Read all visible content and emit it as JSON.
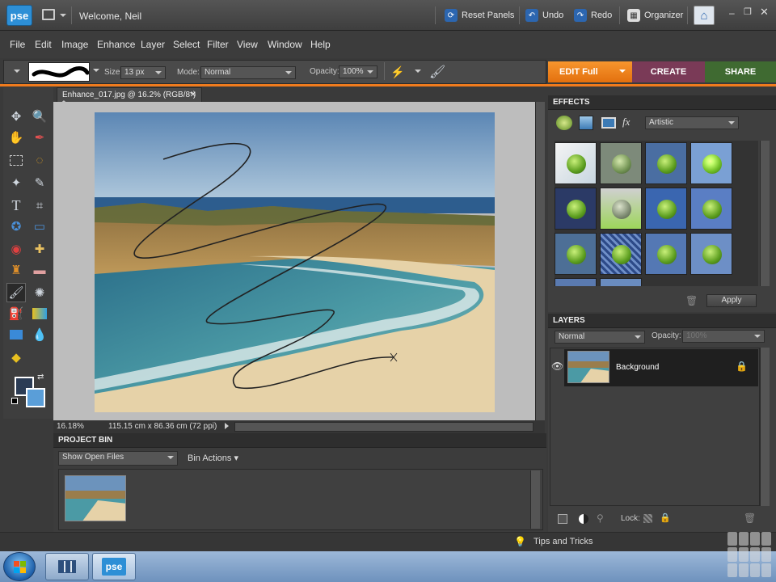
{
  "titlebar": {
    "app_logo": "pse",
    "welcome": "Welcome, Neil",
    "reset_panels": "Reset Panels",
    "undo": "Undo",
    "redo": "Redo",
    "organizer": "Organizer"
  },
  "menu": [
    "File",
    "Edit",
    "Image",
    "Enhance",
    "Layer",
    "Select",
    "Filter",
    "View",
    "Window",
    "Help"
  ],
  "options": {
    "size_label": "Size:",
    "size_value": "13 px",
    "mode_label": "Mode:",
    "mode_value": "Normal",
    "opacity_label": "Opacity:",
    "opacity_value": "100%"
  },
  "mode_tabs": {
    "edit": "EDIT Full",
    "create": "CREATE",
    "share": "SHARE"
  },
  "document": {
    "tab_title": "Enhance_017.jpg @ 16.2% (RGB/8*) *",
    "zoom": "16.18%",
    "dimensions": "115.15 cm x 86.36 cm (72 ppi)"
  },
  "bin": {
    "title": "PROJECT BIN",
    "show_value": "Show Open Files",
    "actions": "Bin Actions"
  },
  "effects": {
    "title": "EFFECTS",
    "category": "Artistic",
    "apply": "Apply"
  },
  "layers": {
    "title": "LAYERS",
    "blend": "Normal",
    "opacity_label": "Opacity:",
    "opacity_value": "100%",
    "layer_name": "Background",
    "lock_label": "Lock:"
  },
  "status": {
    "tips": "Tips and Tricks"
  },
  "taskbar": {
    "pse_label": "pse"
  },
  "colors": {
    "accent_orange": "#f07b1d",
    "create_tab": "#7a3a57",
    "share_tab": "#3f6a31"
  }
}
